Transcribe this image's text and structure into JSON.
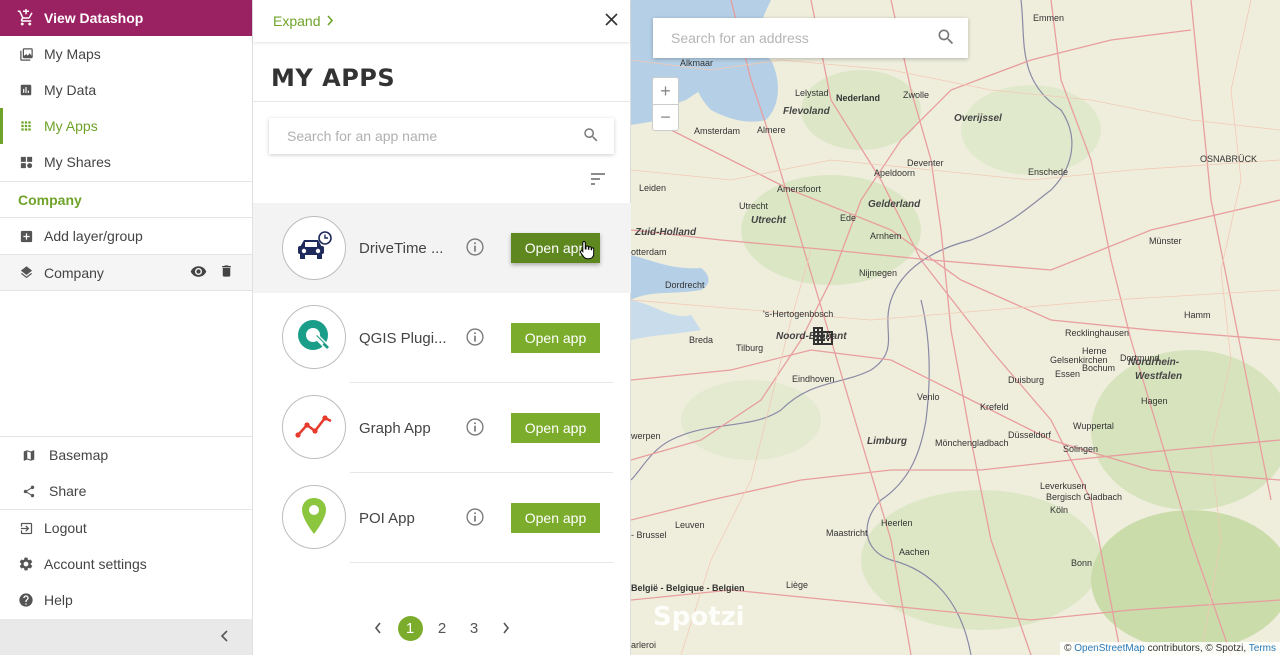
{
  "sidebar": {
    "top": {
      "label": "View Datashop",
      "icon": "cart-icon"
    },
    "nav": [
      {
        "label": "My Maps",
        "icon": "maps-icon",
        "active": false
      },
      {
        "label": "My Data",
        "icon": "bar-chart-icon",
        "active": false
      },
      {
        "label": "My Apps",
        "icon": "grid-icon",
        "active": true
      },
      {
        "label": "My Shares",
        "icon": "shares-icon",
        "active": false
      }
    ],
    "section_title": "Company",
    "add_layer_label": "Add layer/group",
    "layer": {
      "label": "Company",
      "icon": "layers-icon"
    },
    "bottom": [
      {
        "label": "Basemap",
        "icon": "map-icon"
      },
      {
        "label": "Share",
        "icon": "share-icon"
      },
      {
        "label": "Logout",
        "icon": "logout-icon"
      },
      {
        "label": "Account settings",
        "icon": "gear-icon"
      },
      {
        "label": "Help",
        "icon": "help-icon"
      }
    ]
  },
  "panel": {
    "expand_label": "Expand",
    "title": "MY APPS",
    "search_placeholder": "Search for an app name",
    "apps": [
      {
        "name": "DriveTime ...",
        "button": "Open app",
        "logo": "car-clock-icon"
      },
      {
        "name": "QGIS Plugi...",
        "button": "Open app",
        "logo": "qgis-icon"
      },
      {
        "name": "Graph App",
        "button": "Open app",
        "logo": "graph-icon"
      },
      {
        "name": "POI App",
        "button": "Open app",
        "logo": "poi-pin-icon"
      }
    ],
    "pages": [
      "1",
      "2",
      "3"
    ],
    "current_page": "1"
  },
  "map": {
    "search_placeholder": "Search for an address",
    "zoom_in": "+",
    "zoom_out": "−",
    "watermark": "Spotzi",
    "attribution": {
      "prefix": "©",
      "osm": "OpenStreetMap",
      "middle": "contributors, © Spotzi,",
      "terms": "Terms"
    },
    "labels": {
      "emmen": "Emmen",
      "alkmaar": "Alkmaar",
      "lelystad": "Lelystad",
      "nederland": "Nederland",
      "zwolle": "Zwolle",
      "flevoland": "Flevoland",
      "overijssel": "Overijssel",
      "amsterdam": "Amsterdam",
      "almere": "Almere",
      "deventer": "Deventer",
      "enschede": "Enschede",
      "osnabruck": "OSNABRÜCK",
      "leiden": "Leiden",
      "apeldoorn": "Apeldoorn",
      "amersfoort": "Amersfoort",
      "utrecht": "Utrecht",
      "utrecht_prov": "Utrecht",
      "gelderland": "Gelderland",
      "ede": "Ede",
      "zuid_holland": "Zuid-Holland",
      "arnhem": "Arnhem",
      "rotterdam": "otterdam",
      "munster": "Münster",
      "nijmegen": "Nijmegen",
      "dordrecht": "Dordrecht",
      "hertogenbosch": "'s-Hertogenbosch",
      "breda": "Breda",
      "tilburg": "Tilburg",
      "noord_brabant": "Noord-Brabant",
      "recklinghausen": "Recklinghausen",
      "hamm": "Hamm",
      "herne": "Herne",
      "gelsenkirchen": "Gelsenkirchen",
      "dortmund": "Dortmund",
      "bochum": "Bochum",
      "nordrhein": "Nordrhein-",
      "westfalen": "Westfalen",
      "eindhoven": "Eindhoven",
      "duisburg": "Duisburg",
      "essen": "Essen",
      "hagen": "Hagen",
      "venlo": "Venlo",
      "krefeld": "Krefeld",
      "antwerpen": "werpen",
      "limburg": "Limburg",
      "monchengladbach": "Mönchengladbach",
      "dusseldorf": "Düsseldorf",
      "wuppertal": "Wuppertal",
      "solingen": "Solingen",
      "leverkusen": "Leverkusen",
      "bergisch": "Bergisch Gladbach",
      "koln": "Köln",
      "heerlen": "Heerlen",
      "maastricht": "Maastricht",
      "leuven": "Leuven",
      "brussel": "- Brussel",
      "aachen": "Aachen",
      "bonn": "Bonn",
      "belgie": "België - Belgique - Belgien",
      "liege": "Liège",
      "charleroi": "arleroi"
    }
  },
  "colors": {
    "brand": "#9b2262",
    "accent": "#7cac2b"
  }
}
